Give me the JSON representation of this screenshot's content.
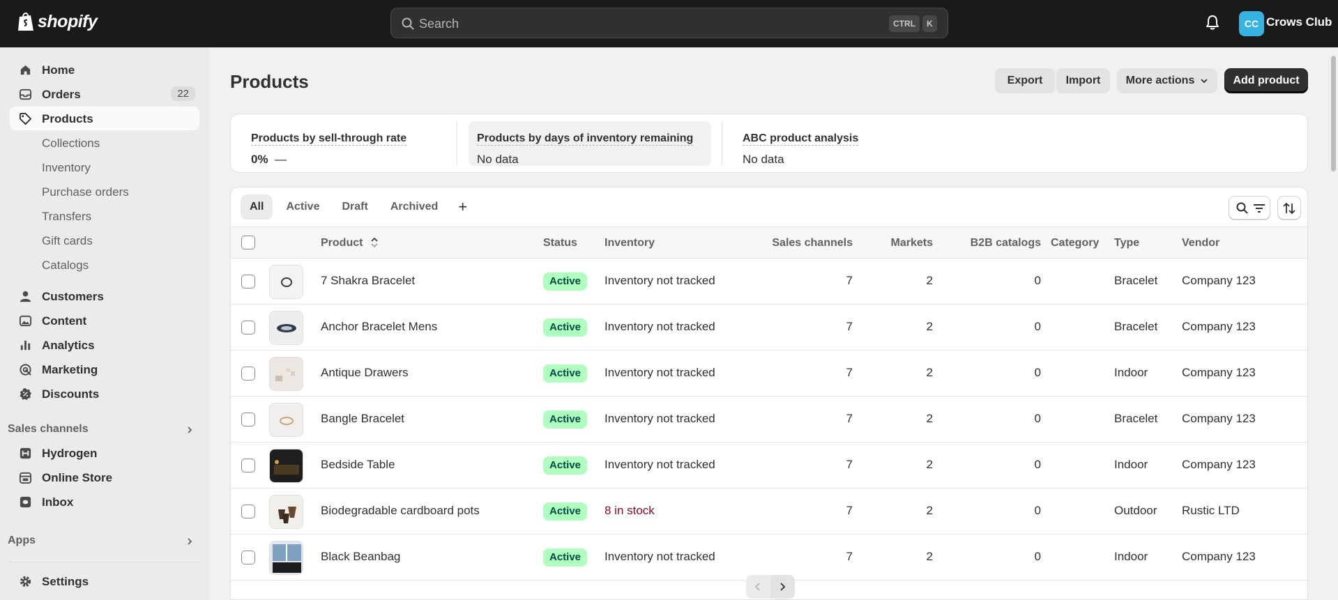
{
  "topbar": {
    "brand": "shopify",
    "search_placeholder": "Search",
    "kbd_ctrl": "CTRL",
    "kbd_k": "K",
    "avatar_initials": "CC",
    "store_name": "Crows Club"
  },
  "sidebar": {
    "home": "Home",
    "orders": "Orders",
    "orders_badge": "22",
    "products": "Products",
    "sub": [
      "Collections",
      "Inventory",
      "Purchase orders",
      "Transfers",
      "Gift cards",
      "Catalogs"
    ],
    "customers": "Customers",
    "content": "Content",
    "analytics": "Analytics",
    "marketing": "Marketing",
    "discounts": "Discounts",
    "sales_channels_title": "Sales channels",
    "channels": [
      "Hydrogen",
      "Online Store",
      "Inbox"
    ],
    "apps_title": "Apps",
    "settings": "Settings"
  },
  "page": {
    "title": "Products",
    "export": "Export",
    "import": "Import",
    "more_actions": "More actions",
    "add_product": "Add product"
  },
  "analytics": {
    "sell_through_title": "Products by sell-through rate",
    "sell_through_value": "0%",
    "sell_through_dash": "—",
    "days_title": "Products by days of inventory remaining",
    "days_value": "No data",
    "abc_title": "ABC product analysis",
    "abc_value": "No data"
  },
  "tabs": [
    "All",
    "Active",
    "Draft",
    "Archived",
    "+"
  ],
  "table": {
    "headers": {
      "product": "Product",
      "status": "Status",
      "inventory": "Inventory",
      "sales_channels": "Sales channels",
      "markets": "Markets",
      "b2b": "B2B catalogs",
      "category": "Category",
      "type": "Type",
      "vendor": "Vendor"
    },
    "rows": [
      {
        "name": "7 Shakra Bracelet",
        "status": "Active",
        "inventory": "Inventory not tracked",
        "channels": "7",
        "markets": "2",
        "b2b": "0",
        "type": "Bracelet",
        "vendor": "Company 123"
      },
      {
        "name": "Anchor Bracelet Mens",
        "status": "Active",
        "inventory": "Inventory not tracked",
        "channels": "7",
        "markets": "2",
        "b2b": "0",
        "type": "Bracelet",
        "vendor": "Company 123"
      },
      {
        "name": "Antique Drawers",
        "status": "Active",
        "inventory": "Inventory not tracked",
        "channels": "7",
        "markets": "2",
        "b2b": "0",
        "type": "Indoor",
        "vendor": "Company 123"
      },
      {
        "name": "Bangle Bracelet",
        "status": "Active",
        "inventory": "Inventory not tracked",
        "channels": "7",
        "markets": "2",
        "b2b": "0",
        "type": "Bracelet",
        "vendor": "Company 123"
      },
      {
        "name": "Bedside Table",
        "status": "Active",
        "inventory": "Inventory not tracked",
        "channels": "7",
        "markets": "2",
        "b2b": "0",
        "type": "Indoor",
        "vendor": "Company 123"
      },
      {
        "name": "Biodegradable cardboard pots",
        "status": "Active",
        "inventory": "8 in stock",
        "channels": "7",
        "markets": "2",
        "b2b": "0",
        "type": "Outdoor",
        "vendor": "Rustic LTD"
      },
      {
        "name": "Black Beanbag",
        "status": "Active",
        "inventory": "Inventory not tracked",
        "channels": "7",
        "markets": "2",
        "b2b": "0",
        "type": "Indoor",
        "vendor": "Company 123"
      }
    ]
  },
  "colors": {
    "topbar": "#1a1a1a",
    "status_active_bg": "#affebf",
    "stock_red": "#8e0b21",
    "avatar": "#36b3e0"
  }
}
